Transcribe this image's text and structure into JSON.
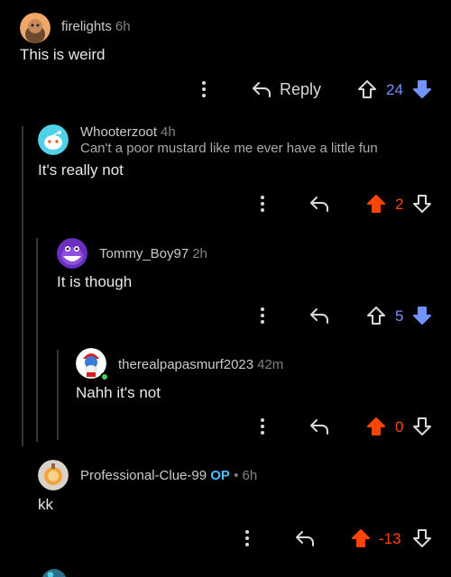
{
  "colors": {
    "background": "#000000",
    "upvoted": "#ff4500",
    "downvoted": "#7193ff",
    "neutral": "#d7dadc",
    "op": "#4fbcff"
  },
  "comments": [
    {
      "username": "firelights",
      "time": "6h",
      "body": "This is weird",
      "reply_label": "Reply",
      "score": "24",
      "vote": "down"
    },
    {
      "username": "Whooterzoot",
      "time": "4h",
      "flair": "Can't a poor mustard like me ever have a little fun",
      "body": "It's really not",
      "score": "2",
      "vote": "up"
    },
    {
      "username": "Tommy_Boy97",
      "time": "2h",
      "body": "It is though",
      "score": "5",
      "vote": "down"
    },
    {
      "username": "therealpapasmurf2023",
      "time": "42m",
      "body": "Nahh it's not",
      "score": "0",
      "vote": "up"
    },
    {
      "username": "Professional-Clue-99",
      "op_badge": "OP",
      "separator": "•",
      "time": "6h",
      "body": "kk",
      "score": "-13",
      "vote": "up"
    }
  ]
}
